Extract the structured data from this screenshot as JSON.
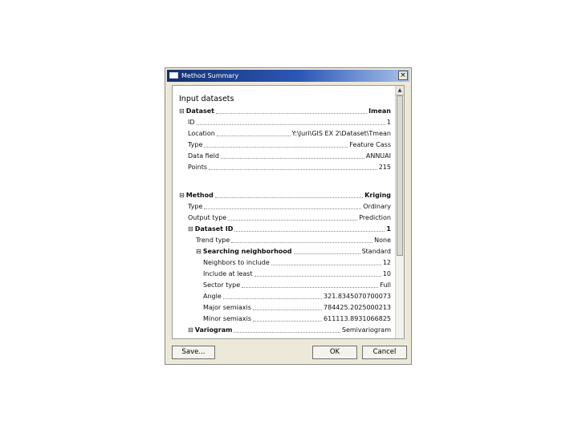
{
  "window": {
    "title": "Method Summary",
    "close_label": "×"
  },
  "input": {
    "heading": "Input datasets",
    "dataset": {
      "toggle": "⊟",
      "label": "Dataset",
      "value": "Imean"
    },
    "rows": [
      {
        "label": "ID",
        "value": "1"
      },
      {
        "label": "Location",
        "value": "Y:\\Juri\\GIS EX 2\\Dataset\\Tmean"
      },
      {
        "label": "Type",
        "value": "Feature Cass"
      },
      {
        "label": "Data field",
        "value": "ANNUAI"
      },
      {
        "label": "Points",
        "value": "215"
      }
    ]
  },
  "method": {
    "toggle": "⊟",
    "label": "Method",
    "value": "Kriging",
    "rows": [
      {
        "label": "Type",
        "value": "Ordinary"
      },
      {
        "label": "Output type",
        "value": "Prediction"
      }
    ],
    "dataset_id": {
      "toggle": "⊟",
      "label": "Dataset ID",
      "value": "1"
    },
    "trend_type": {
      "label": "Trend type",
      "value": "None"
    },
    "searching": {
      "toggle": "⊟",
      "label": "Searching neighborhood",
      "value": "Standard"
    },
    "search_rows": [
      {
        "label": "Neighbors to include",
        "value": "12"
      },
      {
        "label": "Include at least",
        "value": "10"
      },
      {
        "label": "Sector type",
        "value": "Full"
      },
      {
        "label": "Angle",
        "value": "321.8345070700073"
      },
      {
        "label": "Major semiaxis",
        "value": "784425.2025000213"
      },
      {
        "label": "Minor semiaxis",
        "value": "611113.8931066825"
      }
    ],
    "variogram": {
      "toggle": "⊟",
      "label": "Variogram",
      "value": "Semivariogram"
    }
  },
  "buttons": {
    "save": "Save...",
    "ok": "OK",
    "cancel": "Cancel"
  },
  "scroll": {
    "up_icon": "▲",
    "position_fraction": 0
  },
  "colors": {
    "title_dark": "#14306e",
    "title_light": "#a9c2ea",
    "dialog_bg": "#ece9d8"
  }
}
